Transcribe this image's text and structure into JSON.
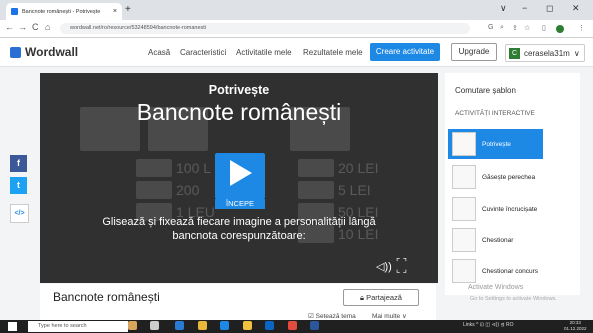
{
  "browser": {
    "tab_title": "Bancnote românești - Potrivește",
    "tab_close": "×",
    "new_tab": "+",
    "url": "wordwall.net/ro/resource/53248594/bancnote-romanesti",
    "nav": {
      "back": "←",
      "forward": "→",
      "reload": "C",
      "home": "⌂"
    },
    "win": {
      "chevron": "∨",
      "minimize": "−",
      "maximize": "◻",
      "close": "✕"
    }
  },
  "site": {
    "logo": "Wordwall",
    "nav": [
      "Acasă",
      "Caracteristici",
      "Activitatile mele",
      "Rezultatele mele"
    ],
    "create_btn": "Creare activitate",
    "upgrade_btn": "Upgrade",
    "user_initial": "C",
    "username": "cerasela31m",
    "user_chevron": "∨"
  },
  "player": {
    "subtitle": "Potrivește",
    "title": "Bancnote românești",
    "start_label": "ÎNCEPE",
    "description": "Glisează și fixează fiecare imagine a personalității lângă bancnota corespunzătoare:",
    "bg_labels": [
      "100 L",
      "200",
      "1 LEU",
      "20 LEI",
      "5 LEI",
      "50 LEI",
      "10 LEI"
    ],
    "sound_icon": "speaker-icon",
    "fullscreen_icon": "fullscreen-icon"
  },
  "share_sidebar": {
    "facebook": "f",
    "twitter": "t",
    "embed": "</>"
  },
  "right_panel": {
    "title": "Comutare șablon",
    "subtitle": "ACTIVITĂȚI INTERACTIVE",
    "templates": [
      {
        "label": "Potrivește",
        "selected": true
      },
      {
        "label": "Găsește perechea",
        "selected": false
      },
      {
        "label": "Cuvinte încrucișate",
        "selected": false
      },
      {
        "label": "Chestionar",
        "selected": false
      },
      {
        "label": "Chestionar concurs",
        "selected": false
      }
    ],
    "activate_title": "Activate Windows",
    "activate_sub": "Go to Settings to activate Windows."
  },
  "card": {
    "title": "Bancnote românești",
    "share_btn": "Partajează",
    "set_theme": "Setează tema",
    "more": "Mai multe ∨"
  },
  "taskbar": {
    "search_placeholder": "Type here to search",
    "tray": "Links  ^  ⊡  ◫  ⊲))  ⊴  RO",
    "time": "20:33",
    "date": "01.12.2022"
  },
  "colors": {
    "accent": "#1e88e5",
    "player_bg": "#303030"
  }
}
